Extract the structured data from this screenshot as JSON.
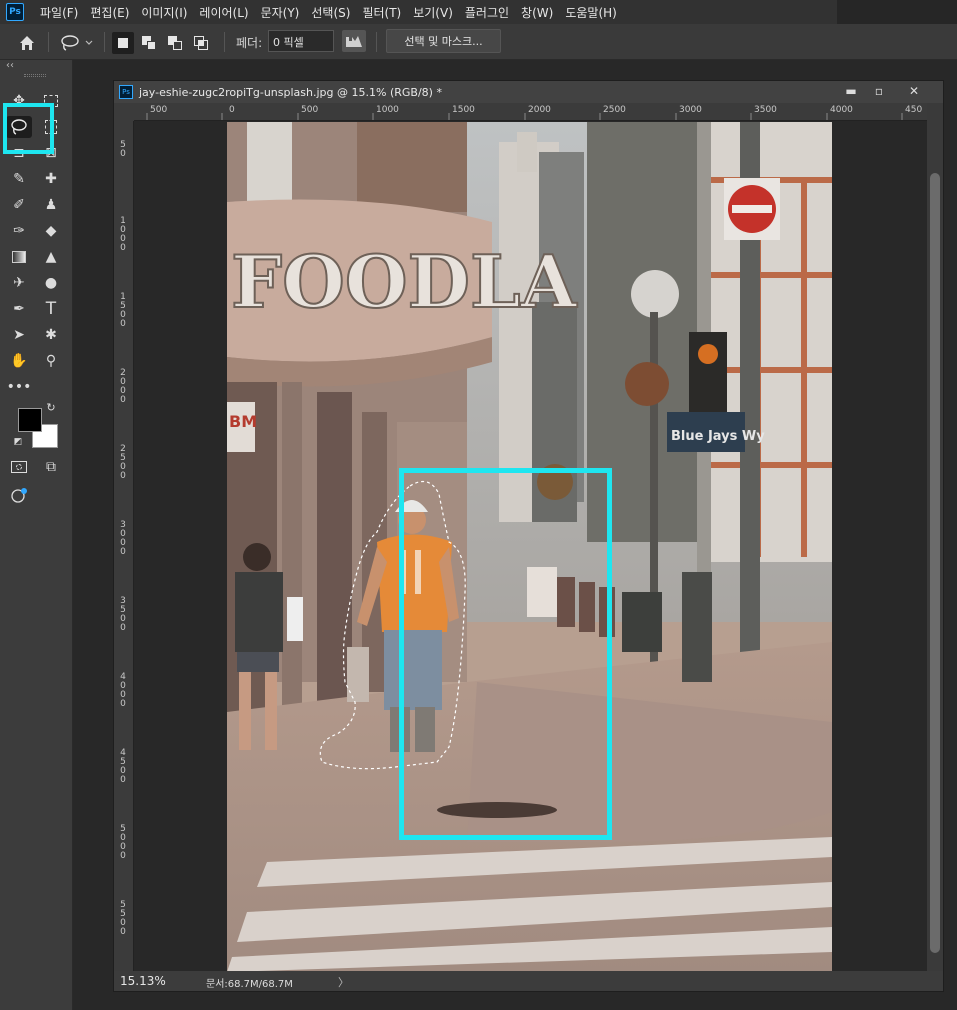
{
  "app": {
    "logo": "Ps"
  },
  "menu": [
    "파일(F)",
    "편집(E)",
    "이미지(I)",
    "레이어(L)",
    "문자(Y)",
    "선택(S)",
    "필터(T)",
    "보기(V)",
    "플러그인",
    "창(W)",
    "도움말(H)"
  ],
  "options_bar": {
    "feather_label": "페더:",
    "feather_value": "0 픽셀",
    "select_mask_label": "선택 및 마스크..."
  },
  "toolbar": {
    "collapse_label": "‹‹"
  },
  "document": {
    "title": "jay-eshie-zugc2ropiTg-unsplash.jpg @ 15.1% (RGB/8) *",
    "icon_label": "Ps",
    "zoom": "15.13%",
    "doc_size": "문서:68.7M/68.7M",
    "status_arrow": "〉",
    "window_controls": {
      "minimize": "▬",
      "restore": "▫",
      "close": "✕"
    }
  },
  "photo_text": {
    "sign": "FOODLA",
    "street_sign": "Blue Jays Wy",
    "store_sign": "BM"
  },
  "ruler": {
    "horizontal": [
      "500",
      "0",
      "500",
      "1000",
      "1500",
      "2000",
      "2500",
      "3000",
      "3500",
      "4000",
      "450"
    ],
    "vertical": [
      "5 0",
      "1 0 0 0",
      "1 5 0 0",
      "2 0 0 0",
      "2 5 0 0",
      "3 0 0 0",
      "3 5 0 0",
      "4 0 0 0",
      "4 5 0 0",
      "5 0 0 0",
      "5 5 0 0"
    ]
  },
  "colors": {
    "highlight": "#1ee6f0",
    "foreground": "#000000",
    "background": "#ffffff"
  }
}
